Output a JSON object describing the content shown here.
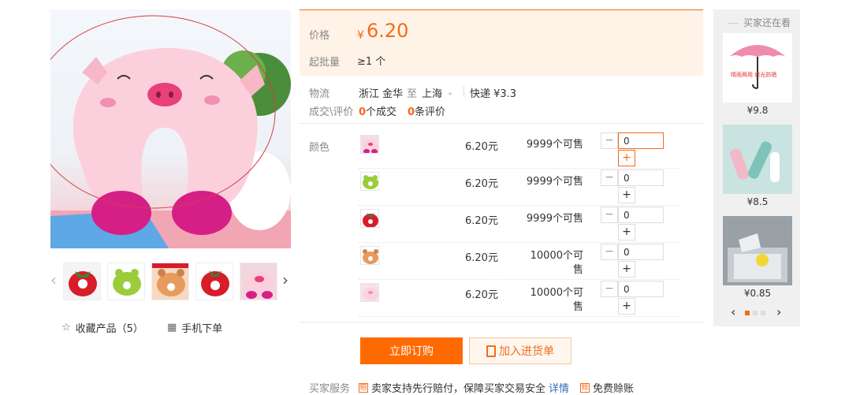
{
  "price": {
    "label": "价格",
    "currency": "¥",
    "value": "6.20"
  },
  "moq": {
    "label": "起批量",
    "value": "≥1 个"
  },
  "logistics": {
    "label": "物流",
    "from": "浙江 金华",
    "to_word": "至",
    "dest": "上海",
    "ship": "快递 ¥3.3"
  },
  "deals": {
    "label": "成交\\评价",
    "count": "0",
    "count_unit": "个成交",
    "reviews": "0",
    "reviews_unit": "条评价"
  },
  "sku": {
    "label": "颜色",
    "rows": [
      {
        "price": "6.20元",
        "stock": "9999个可售",
        "qty": "0",
        "swatch": "pink-pig"
      },
      {
        "price": "6.20元",
        "stock": "9999个可售",
        "qty": "0",
        "swatch": "green-frog"
      },
      {
        "price": "6.20元",
        "stock": "9999个可售",
        "qty": "0",
        "swatch": "red-strawberry"
      },
      {
        "price": "6.20元",
        "stock": "10000个可售",
        "qty": "0",
        "swatch": "brown-bear"
      },
      {
        "price": "6.20元",
        "stock": "10000个可售",
        "qty": "0",
        "swatch": "light-pink-pig"
      }
    ]
  },
  "actions": {
    "order": "立即订购",
    "cart": "加入进货单"
  },
  "service": {
    "label": "买家服务",
    "item1": "卖家支持先行赔付，保障买家交易安全",
    "link": "详情",
    "item2": "免费赊账"
  },
  "gallery": {
    "favorite": "收藏产品（5）",
    "mobile": "手机下单",
    "thumbs": [
      "red-strawberry",
      "green-frog",
      "brown-bear",
      "red-strawberry",
      "pink-pig"
    ]
  },
  "sidebar": {
    "title": "买家还在看",
    "items": [
      {
        "price": "¥9.8",
        "caption": "晴雨两用\n遮光防晒"
      },
      {
        "price": "¥8.5"
      },
      {
        "price": "¥0.85"
      }
    ]
  },
  "colors": {
    "accent": "#f26c18",
    "price_bg": "#fff3e8",
    "button": "#ff6a00"
  }
}
